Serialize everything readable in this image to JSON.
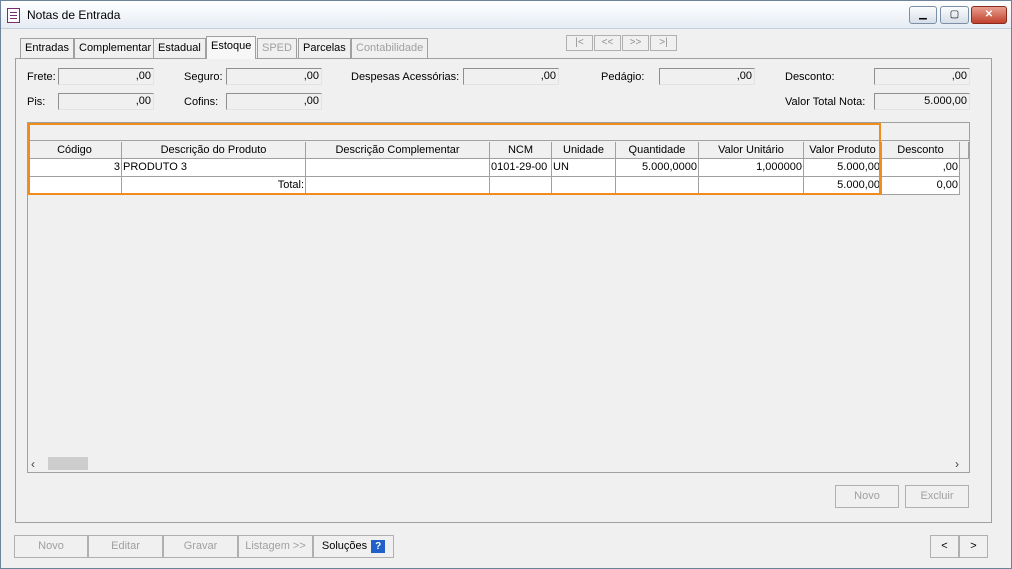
{
  "window": {
    "title": "Notas de Entrada"
  },
  "tabs": [
    {
      "label": "Entradas"
    },
    {
      "label": "Complementar"
    },
    {
      "label": "Estadual"
    },
    {
      "label": "Estoque"
    },
    {
      "label": "SPED"
    },
    {
      "label": "Parcelas"
    },
    {
      "label": "Contabilidade"
    }
  ],
  "nav": {
    "first": "|<",
    "prev": "<<",
    "next": ">>",
    "last": ">|"
  },
  "fields": {
    "frete": {
      "label": "Frete:",
      "value": ",00"
    },
    "seguro": {
      "label": "Seguro:",
      "value": ",00"
    },
    "despesas": {
      "label": "Despesas Acessórias:",
      "value": ",00"
    },
    "pedagio": {
      "label": "Pedágio:",
      "value": ",00"
    },
    "desconto": {
      "label": "Desconto:",
      "value": ",00"
    },
    "pis": {
      "label": "Pis:",
      "value": ",00"
    },
    "cofins": {
      "label": "Cofins:",
      "value": ",00"
    },
    "valor_total": {
      "label": "Valor Total Nota:",
      "value": "5.000,00"
    }
  },
  "grid": {
    "columns": [
      "Código",
      "Descrição do Produto",
      "Descrição Complementar",
      "NCM",
      "Unidade",
      "Quantidade",
      "Valor Unitário",
      "Valor Produto",
      "Desconto"
    ],
    "rows": [
      {
        "codigo": "3",
        "descricao": "PRODUTO 3",
        "complementar": "",
        "ncm": "0101-29-00",
        "unidade": "UN",
        "quantidade": "5.000,0000",
        "unitario": "1,000000",
        "produto": "5.000,00",
        "desconto": ",00"
      }
    ],
    "total": {
      "label": "Total:",
      "produto": "5.000,00",
      "desconto": "0,00"
    }
  },
  "panel_buttons": {
    "novo": "Novo",
    "excluir": "Excluir"
  },
  "bottom": {
    "novo": "Novo",
    "editar": "Editar",
    "gravar": "Gravar",
    "listagem": "Listagem >>",
    "solucoes": "Soluções",
    "help": "?",
    "prev": "<",
    "next": ">"
  }
}
